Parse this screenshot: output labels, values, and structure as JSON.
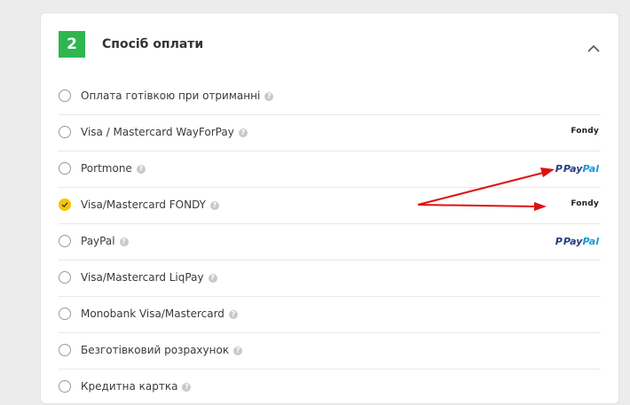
{
  "section": {
    "step": "2",
    "title": "Спосіб оплати"
  },
  "options": [
    {
      "label": "Оплата готівкою при отриманні",
      "help": "?",
      "checked": false,
      "logo": ""
    },
    {
      "label": "Visa / Mastercard WayForPay",
      "help": "?",
      "checked": false,
      "logo": "Fondy"
    },
    {
      "label": "Portmone",
      "help": "?",
      "checked": false,
      "logo": "PayPal"
    },
    {
      "label": "Visa/Mastercard FONDY",
      "help": "?",
      "checked": true,
      "logo": "Fondy"
    },
    {
      "label": "PayPal",
      "help": "?",
      "checked": false,
      "logo": "PayPal"
    },
    {
      "label": "Visa/Mastercard LiqPay",
      "help": "?",
      "checked": false,
      "logo": ""
    },
    {
      "label": "Monobank Visa/Mastercard",
      "help": "?",
      "checked": false,
      "logo": ""
    },
    {
      "label": "Безготівковий розрахунок",
      "help": "?",
      "checked": false,
      "logo": ""
    },
    {
      "label": "Кредитна картка",
      "help": "?",
      "checked": false,
      "logo": ""
    }
  ],
  "logos": {
    "fondy": "Fondy",
    "paypal_pay": "Pay",
    "paypal_pal": "Pal"
  },
  "icons": {
    "collapse": "chevron-up-icon",
    "check": "check-icon",
    "help": "question-icon"
  },
  "colors": {
    "accent_green": "#2eb64f",
    "radio_checked": "#f6c400",
    "annotation_arrow": "#e01010",
    "paypal_dark": "#253b80",
    "paypal_light": "#179bd7"
  }
}
